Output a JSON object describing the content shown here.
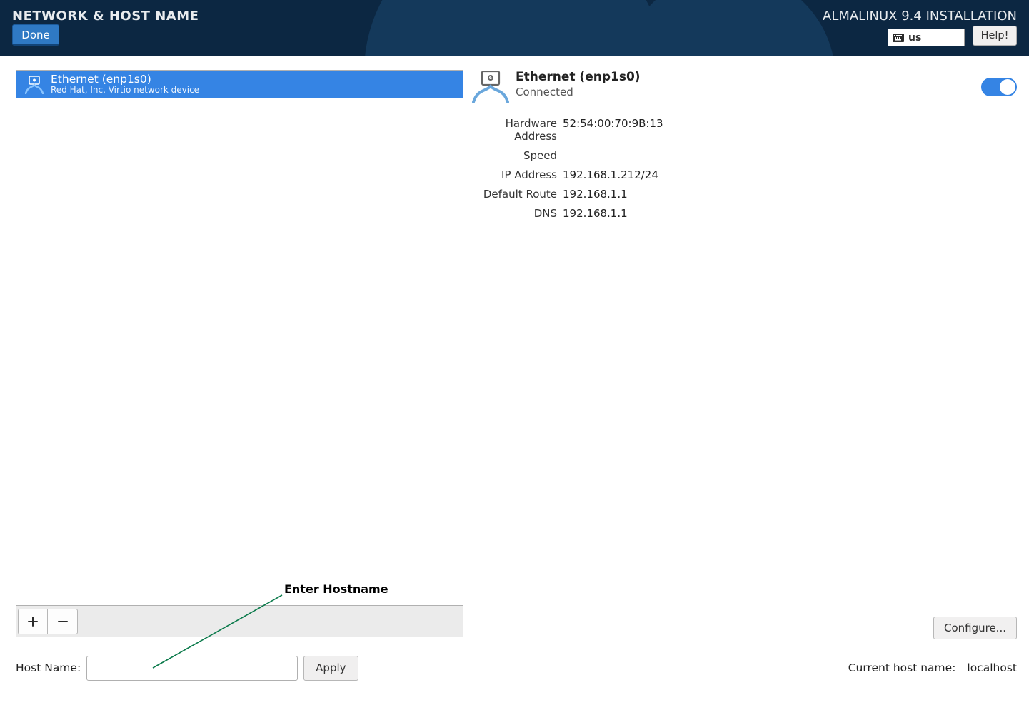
{
  "header": {
    "title": "NETWORK & HOST NAME",
    "done_label": "Done",
    "install_title": "ALMALINUX 9.4 INSTALLATION",
    "help_label": "Help!",
    "keyboard_layout": "us"
  },
  "devices": [
    {
      "name": "Ethernet (enp1s0)",
      "sub": "Red Hat, Inc. Virtio network device"
    }
  ],
  "detail": {
    "name": "Ethernet (enp1s0)",
    "status": "Connected",
    "rows": {
      "hardware_address": {
        "label": "Hardware Address",
        "value": "52:54:00:70:9B:13"
      },
      "speed": {
        "label": "Speed",
        "value": ""
      },
      "ip": {
        "label": "IP Address",
        "value": "192.168.1.212/24"
      },
      "route": {
        "label": "Default Route",
        "value": "192.168.1.1"
      },
      "dns": {
        "label": "DNS",
        "value": "192.168.1.1"
      }
    },
    "configure_label": "Configure..."
  },
  "hostname": {
    "label": "Host Name:",
    "value": "",
    "apply_label": "Apply",
    "current_label": "Current host name:",
    "current_value": "localhost"
  },
  "annotation": {
    "text": "Enter Hostname"
  }
}
